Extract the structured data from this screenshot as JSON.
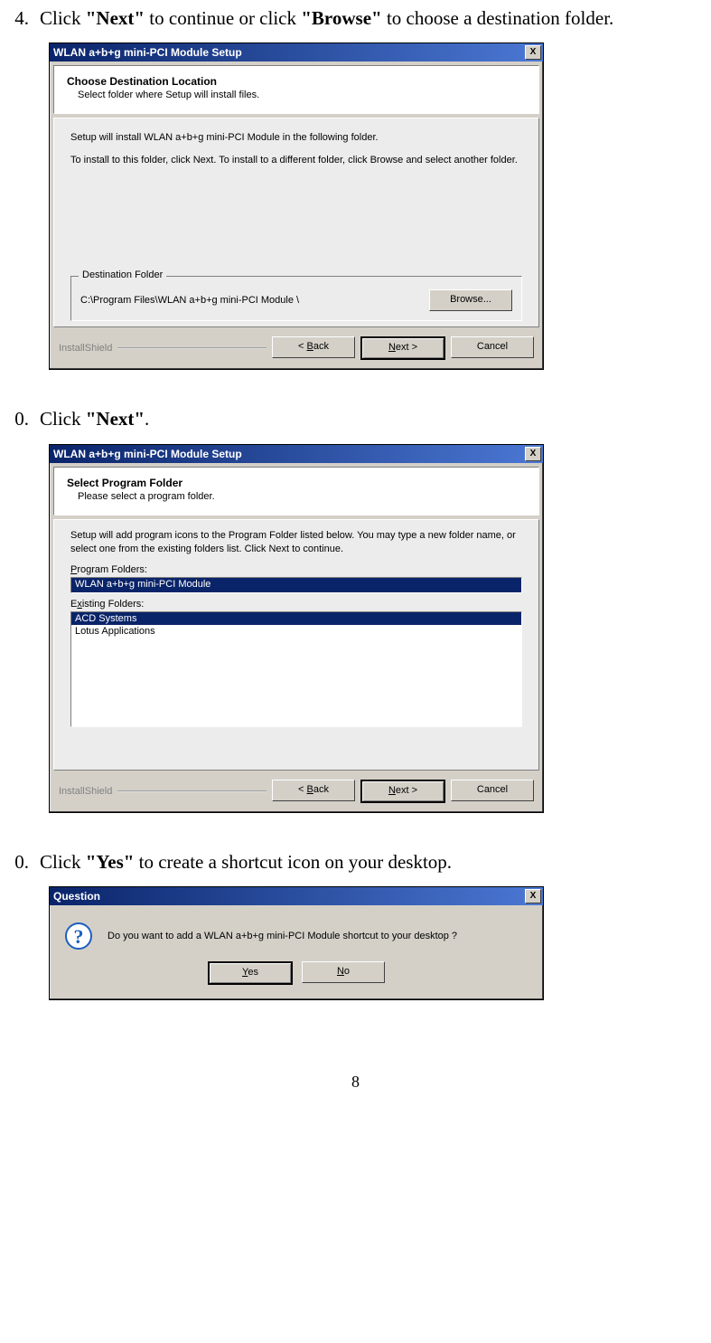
{
  "steps": {
    "s1": {
      "num": "4.",
      "pre": "Click ",
      "bold1": "\"Next\"",
      "mid": " to continue or click ",
      "bold2": "\"Browse\"",
      "post": " to choose a destination folder."
    },
    "s2": {
      "num": "0.",
      "pre": "Click ",
      "bold1": "\"Next\"",
      "post": "."
    },
    "s3": {
      "num": "0.",
      "pre": "Click ",
      "bold1": "\"Yes\"",
      "post": " to create a shortcut icon on your desktop."
    }
  },
  "dlg1": {
    "title": "WLAN a+b+g mini-PCI Module Setup",
    "hdr": "Choose Destination Location",
    "sub": "Select folder where Setup will install files.",
    "line1": "Setup will install WLAN a+b+g  mini-PCI Module in the following folder.",
    "line2": "To install to this folder, click Next. To install to a different folder, click Browse and select another folder.",
    "grp": "Destination Folder",
    "path": "C:\\Program Files\\WLAN a+b+g mini-PCI Module \\",
    "browse": "Browse...",
    "brand": "InstallShield",
    "back": "< Back",
    "next": "Next >",
    "cancel": "Cancel"
  },
  "dlg2": {
    "title": "WLAN a+b+g mini-PCI Module Setup",
    "hdr": "Select Program Folder",
    "sub": "Please select a program folder.",
    "desc": "Setup will add program icons to the Program Folder listed below.  You may type a new folder name, or select one from the existing folders list.  Click Next to continue.",
    "lbl_pf": "Program Folders:",
    "pf_value": "WLAN a+b+g mini-PCI Module",
    "lbl_ef": "Existing Folders:",
    "ef_items": [
      "ACD Systems",
      "Lotus Applications"
    ],
    "brand": "InstallShield",
    "back": "< Back",
    "next": "Next >",
    "cancel": "Cancel"
  },
  "dlg3": {
    "title": "Question",
    "msg": "Do you want to add a WLAN a+b+g mini-PCI Module shortcut to your desktop ?",
    "yes": "Yes",
    "no": "No"
  },
  "page_number": "8"
}
